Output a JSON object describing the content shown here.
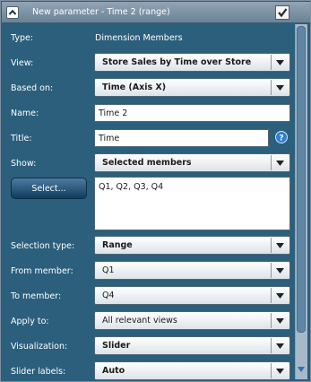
{
  "header": {
    "title": "New parameter - Time 2 (range)"
  },
  "fields": {
    "type": {
      "label": "Type:",
      "value": "Dimension Members"
    },
    "view": {
      "label": "View:",
      "value": "Store Sales by Time over Store"
    },
    "based_on": {
      "label": "Based on:",
      "value": "Time (Axis X)"
    },
    "name": {
      "label": "Name:",
      "value": "Time 2"
    },
    "title": {
      "label": "Title:",
      "value": "Time"
    },
    "show": {
      "label": "Show:",
      "value": "Selected members"
    },
    "select_button": {
      "label": "Select..."
    },
    "selected_members": {
      "value": "Q1, Q2, Q3, Q4"
    },
    "selection_type": {
      "label": "Selection type:",
      "value": "Range"
    },
    "from_member": {
      "label": "From member:",
      "value": "Q1"
    },
    "to_member": {
      "label": "To member:",
      "value": "Q4"
    },
    "apply_to": {
      "label": "Apply to:",
      "value": "All relevant views"
    },
    "visualization": {
      "label": "Visualization:",
      "value": "Slider"
    },
    "slider_labels": {
      "label": "Slider labels:",
      "value": "Auto"
    }
  },
  "icons": {
    "collapse": "chevron-up-icon",
    "enabled_check": "checkmark-icon",
    "help": "question-mark-icon",
    "dropdown": "triangle-down-icon"
  },
  "colors": {
    "panel_background": "#2b5f7c",
    "header_background": "#7f94a6",
    "button_background": "#1f4f74",
    "help_icon": "#2f7fd6"
  }
}
